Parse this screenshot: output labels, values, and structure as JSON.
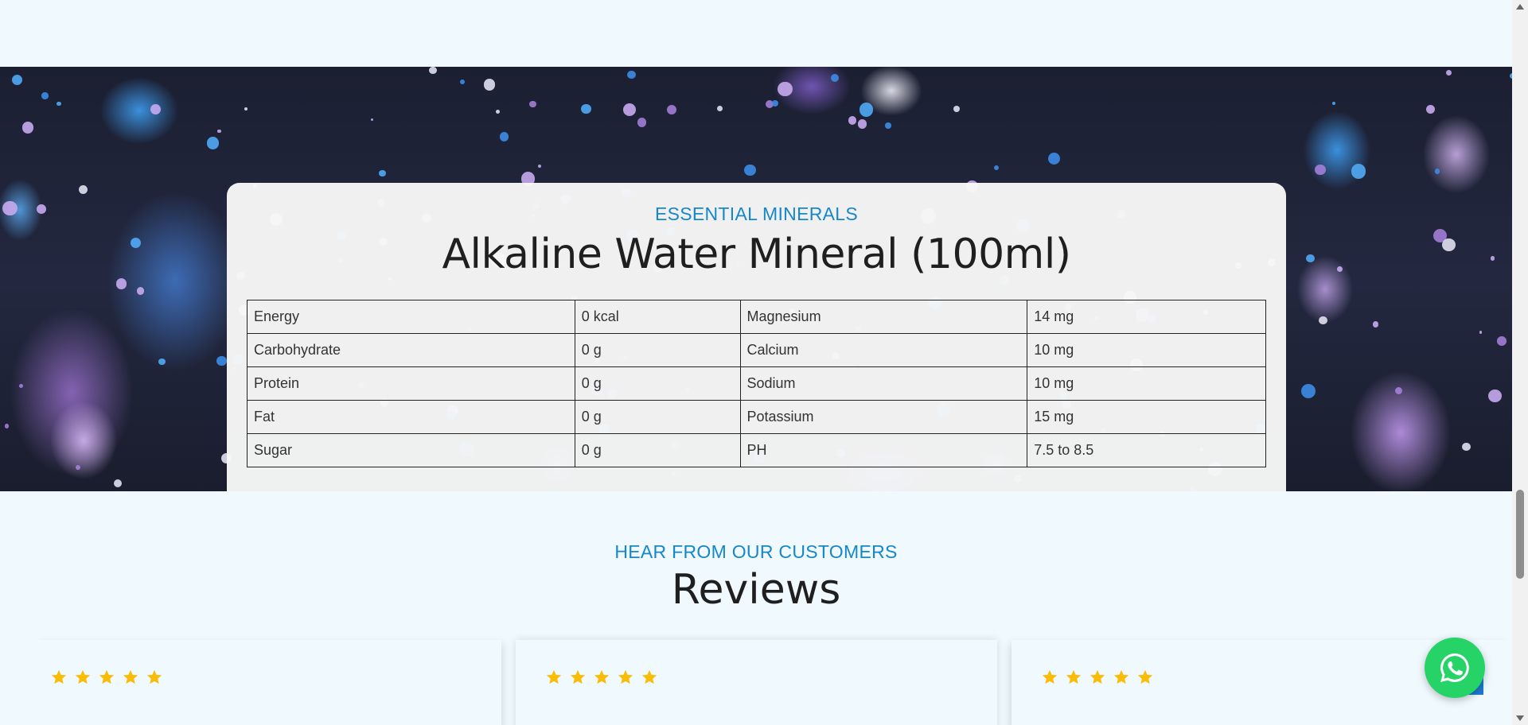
{
  "minerals": {
    "eyebrow": "ESSENTIAL MINERALS",
    "title": "Alkaline Water Mineral (100ml)",
    "rows": [
      [
        "Energy",
        "0 kcal",
        "Magnesium",
        "14 mg"
      ],
      [
        "Carbohydrate",
        "0 g",
        "Calcium",
        "10 mg"
      ],
      [
        "Protein",
        "0 g",
        "Sodium",
        "10 mg"
      ],
      [
        "Fat",
        "0 g",
        "Potassium",
        "15 mg"
      ],
      [
        "Sugar",
        "0 g",
        "PH",
        "7.5 to 8.5"
      ]
    ]
  },
  "reviews": {
    "eyebrow": "HEAR FROM OUR CUSTOMERS",
    "title": "Reviews",
    "cards": [
      {
        "rating": 5
      },
      {
        "rating": 5
      },
      {
        "rating": 5
      }
    ]
  },
  "colors": {
    "accent": "#1687c8",
    "page_bg": "#eff9fe",
    "star": "#fbbc05",
    "whatsapp": "#25d366"
  },
  "icons": {
    "star": "star-icon",
    "whatsapp": "whatsapp-icon",
    "scroll_up": "scroll-up-arrow-icon",
    "scroll_down": "scroll-down-arrow-icon"
  }
}
